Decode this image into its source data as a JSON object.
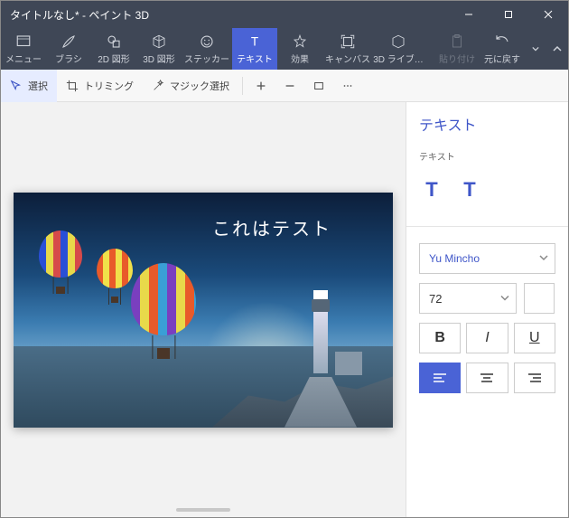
{
  "window": {
    "title": "タイトルなし* - ペイント 3D"
  },
  "ribbon": {
    "menu": "メニュー",
    "brushes": "ブラシ",
    "shapes2d": "2D 図形",
    "shapes3d": "3D 図形",
    "stickers": "ステッカー",
    "text": "テキスト",
    "effects": "効果",
    "canvas": "キャンバス",
    "lib3d": "3D ライブ…",
    "paste": "貼り付け",
    "undo": "元に戻す"
  },
  "subbar": {
    "select": "選択",
    "crop": "トリミング",
    "magic": "マジック選択"
  },
  "canvas": {
    "text_content": "これはテスト"
  },
  "sidebar": {
    "title": "テキスト",
    "section_label": "テキスト",
    "btn2d_glyph": "T",
    "btn3d_glyph": "T",
    "font": "Yu Mincho",
    "size": "72",
    "bold": "B",
    "italic": "I",
    "underline": "U"
  }
}
